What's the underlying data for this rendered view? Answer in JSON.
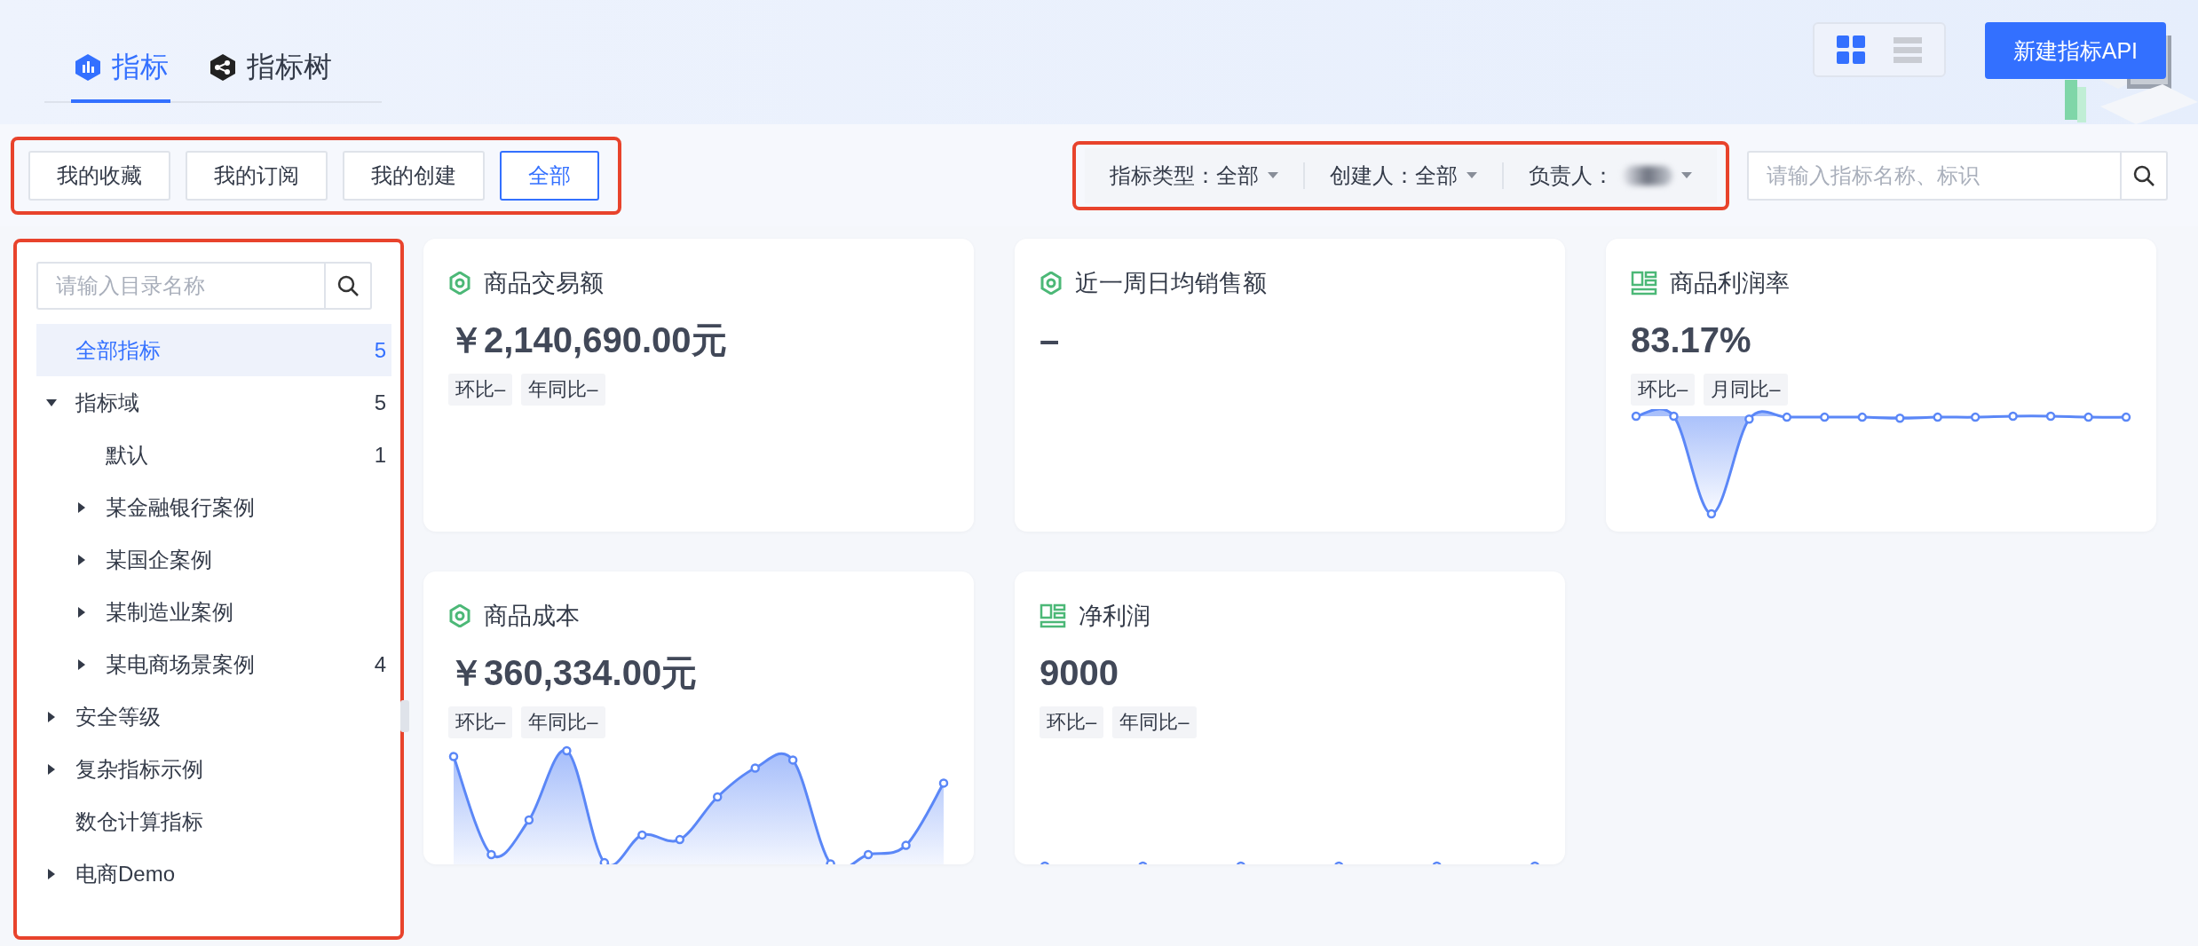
{
  "header": {
    "tabs": [
      {
        "label": "指标",
        "kind": "metric",
        "selected": true
      },
      {
        "label": "指标树",
        "kind": "tree",
        "selected": false
      }
    ],
    "view_toggle": [
      {
        "kind": "grid",
        "selected": true
      },
      {
        "kind": "list",
        "selected": false
      }
    ],
    "create_button": "新建指标API"
  },
  "scope_buttons": [
    {
      "label": "我的收藏",
      "selected": false
    },
    {
      "label": "我的订阅",
      "selected": false
    },
    {
      "label": "我的创建",
      "selected": false
    },
    {
      "label": "全部",
      "selected": true
    }
  ],
  "filters": [
    {
      "label": "指标类型：",
      "value": "全部"
    },
    {
      "label": "创建人：",
      "value": "全部"
    },
    {
      "label": "负责人：",
      "redacted": true
    }
  ],
  "search": {
    "placeholder": "请输入指标名称、标识"
  },
  "sidebar": {
    "search": {
      "placeholder": "请输入目录名称"
    },
    "items": [
      {
        "label": "全部指标",
        "count": "5",
        "kind": "leaf",
        "selected": true
      },
      {
        "label": "指标域",
        "count": "5",
        "kind": "folder",
        "expanded": true,
        "selected": false,
        "children": [
          {
            "label": "默认",
            "count": "1",
            "kind": "leaf",
            "selected": false
          },
          {
            "label": "某金融银行案例",
            "kind": "folder",
            "expanded": false,
            "selected": false
          },
          {
            "label": "某国企案例",
            "kind": "folder",
            "expanded": false,
            "selected": false
          },
          {
            "label": "某制造业案例",
            "kind": "folder",
            "expanded": false,
            "selected": false
          },
          {
            "label": "某电商场景案例",
            "count": "4",
            "kind": "folder",
            "expanded": false,
            "selected": false
          }
        ]
      },
      {
        "label": "安全等级",
        "kind": "folder",
        "expanded": false,
        "selected": false
      },
      {
        "label": "复杂指标示例",
        "kind": "folder",
        "expanded": false,
        "selected": false
      },
      {
        "label": "数仓计算指标",
        "kind": "leaf",
        "selected": false
      },
      {
        "label": "电商Demo",
        "kind": "folder",
        "expanded": false,
        "selected": false
      }
    ]
  },
  "cards": [
    {
      "title": "商品交易额",
      "kind": "gear",
      "value": "￥2,140,690.00元",
      "tags": [
        "环比–",
        "年同比–"
      ]
    },
    {
      "title": "近一周日均销售额",
      "kind": "gear",
      "value": "–"
    },
    {
      "title": "商品利润率",
      "kind": "layout",
      "value": "83.17%",
      "tags": [
        "环比–",
        "月同比–"
      ]
    },
    {
      "title": "商品成本",
      "kind": "gear",
      "value": "￥360,334.00元",
      "tags": [
        "环比–",
        "年同比–"
      ]
    },
    {
      "title": "净利润",
      "kind": "layout",
      "value": "9000",
      "tags": [
        "环比–",
        "年同比–"
      ]
    }
  ]
}
